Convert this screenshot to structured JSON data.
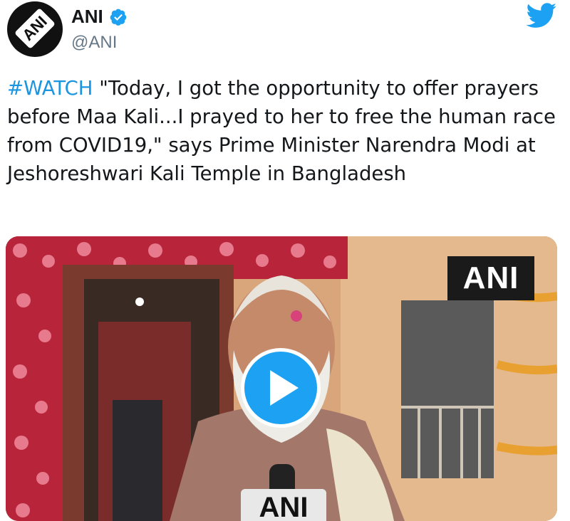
{
  "author": {
    "display_name": "ANI",
    "handle": "@ANI",
    "avatar_icon": "ani-logo-avatar",
    "avatar_text": "ANI",
    "verified_icon": "verified-badge-icon",
    "verified_color": "#1da1f2"
  },
  "platform_icon": "twitter-bird-icon",
  "tweet": {
    "hashtag": "#WATCH",
    "text": " \"Today, I got the opportunity to offer prayers before Maa Kali...I prayed to her to free the human race from COVID19,\" says Prime Minister Narendra Modi at Jeshoreshwari Kali Temple in Bangladesh",
    "hashtag_color": "#1b95e0"
  },
  "media": {
    "type": "video",
    "watermark": "ANI",
    "mic_label": "ANI",
    "play_icon": "play-icon",
    "play_button_color": "#1da1f2"
  }
}
